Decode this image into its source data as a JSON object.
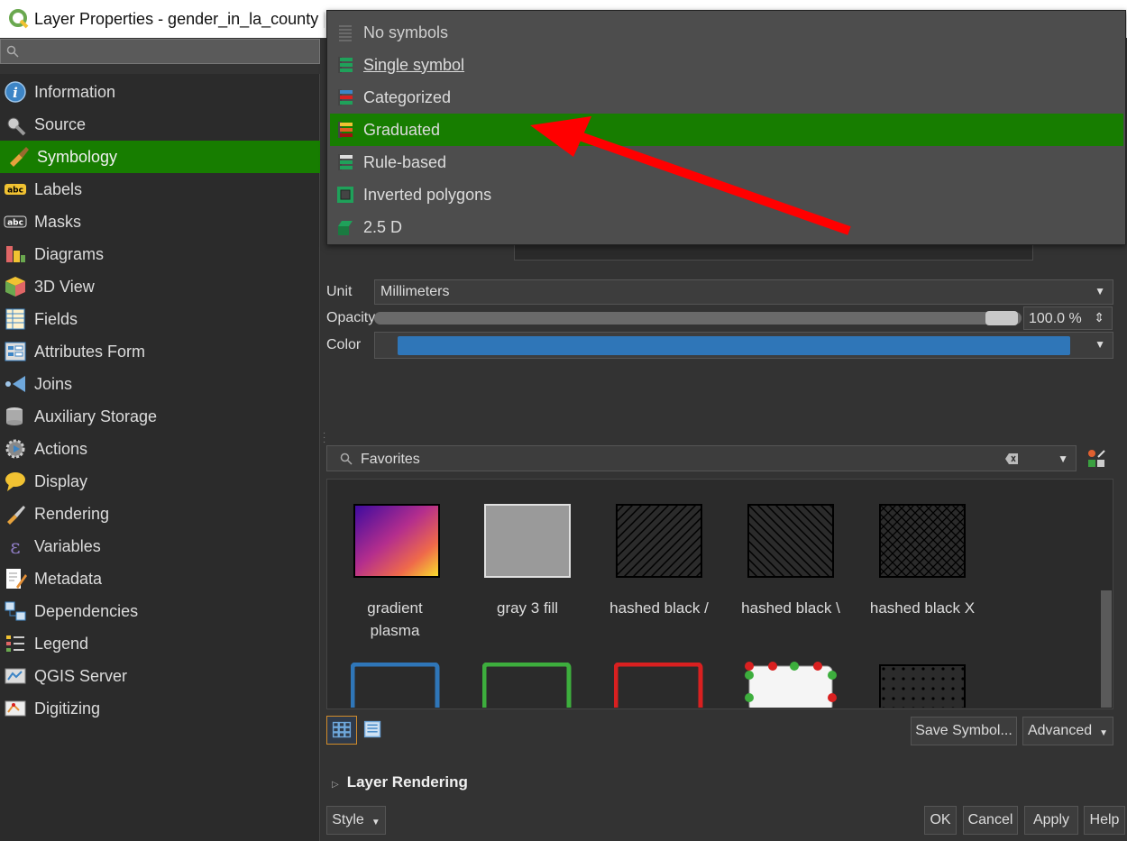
{
  "window": {
    "title": "Layer Properties - gender_in_la_county | Symbology"
  },
  "sidebar": {
    "items": [
      {
        "label": "Information",
        "icon": "info-icon"
      },
      {
        "label": "Source",
        "icon": "source-wrench-icon"
      },
      {
        "label": "Symbology",
        "icon": "symbology-brush-icon",
        "selected": true
      },
      {
        "label": "Labels",
        "icon": "labels-abc-icon"
      },
      {
        "label": "Masks",
        "icon": "masks-abc-icon"
      },
      {
        "label": "Diagrams",
        "icon": "diagrams-icon"
      },
      {
        "label": "3D View",
        "icon": "cube-3d-icon"
      },
      {
        "label": "Fields",
        "icon": "fields-table-icon"
      },
      {
        "label": "Attributes Form",
        "icon": "attributes-form-icon"
      },
      {
        "label": "Joins",
        "icon": "joins-icon"
      },
      {
        "label": "Auxiliary Storage",
        "icon": "database-icon"
      },
      {
        "label": "Actions",
        "icon": "actions-gear-icon"
      },
      {
        "label": "Display",
        "icon": "display-bubble-icon"
      },
      {
        "label": "Rendering",
        "icon": "rendering-brush-icon"
      },
      {
        "label": "Variables",
        "icon": "variables-epsilon-icon"
      },
      {
        "label": "Metadata",
        "icon": "metadata-pencil-icon"
      },
      {
        "label": "Dependencies",
        "icon": "dependencies-icon"
      },
      {
        "label": "Legend",
        "icon": "legend-icon"
      },
      {
        "label": "QGIS Server",
        "icon": "qgis-server-icon"
      },
      {
        "label": "Digitizing",
        "icon": "digitizing-icon"
      }
    ]
  },
  "renderer_menu": {
    "items": [
      {
        "label": "No symbols",
        "icon": "no-symbols-icon"
      },
      {
        "label": "Single symbol",
        "icon": "single-symbol-icon",
        "underlined": true
      },
      {
        "label": "Categorized",
        "icon": "categorized-icon"
      },
      {
        "label": "Graduated",
        "icon": "graduated-icon",
        "highlighted": true
      },
      {
        "label": "Rule-based",
        "icon": "rule-based-icon"
      },
      {
        "label": "Inverted polygons",
        "icon": "inverted-polygons-icon"
      },
      {
        "label": "2.5 D",
        "icon": "two-five-d-icon"
      }
    ]
  },
  "symbol": {
    "unit_label": "Unit",
    "unit_value": "Millimeters",
    "opacity_label": "Opacity",
    "opacity_value": "100.0 %",
    "opacity_fraction": 1.0,
    "color_label": "Color",
    "color_value": "#2f76b8"
  },
  "library": {
    "filter_value": "Favorites",
    "tiles": [
      {
        "name": "gradient\nplasma",
        "icon": "gradient-plasma-fill"
      },
      {
        "name": "gray 3 fill",
        "icon": "gray-fill"
      },
      {
        "name": "hashed black /",
        "icon": "hashed-forward-fill"
      },
      {
        "name": "hashed black \\",
        "icon": "hashed-back-fill"
      },
      {
        "name": "hashed black X",
        "icon": "hashed-cross-fill"
      },
      {
        "name": "",
        "icon": "blue-outline"
      },
      {
        "name": "",
        "icon": "green-outline"
      },
      {
        "name": "",
        "icon": "red-outline"
      },
      {
        "name": "",
        "icon": "vertex-markers"
      },
      {
        "name": "",
        "icon": "dotted-fill"
      }
    ]
  },
  "buttons": {
    "save_symbol": "Save Symbol...",
    "advanced": "Advanced",
    "style": "Style",
    "ok": "OK",
    "cancel": "Cancel",
    "apply": "Apply",
    "help": "Help"
  },
  "sections": {
    "layer_rendering": "Layer Rendering"
  },
  "colors": {
    "selection": "#177d00",
    "annotation_arrow": "#ff0000"
  }
}
